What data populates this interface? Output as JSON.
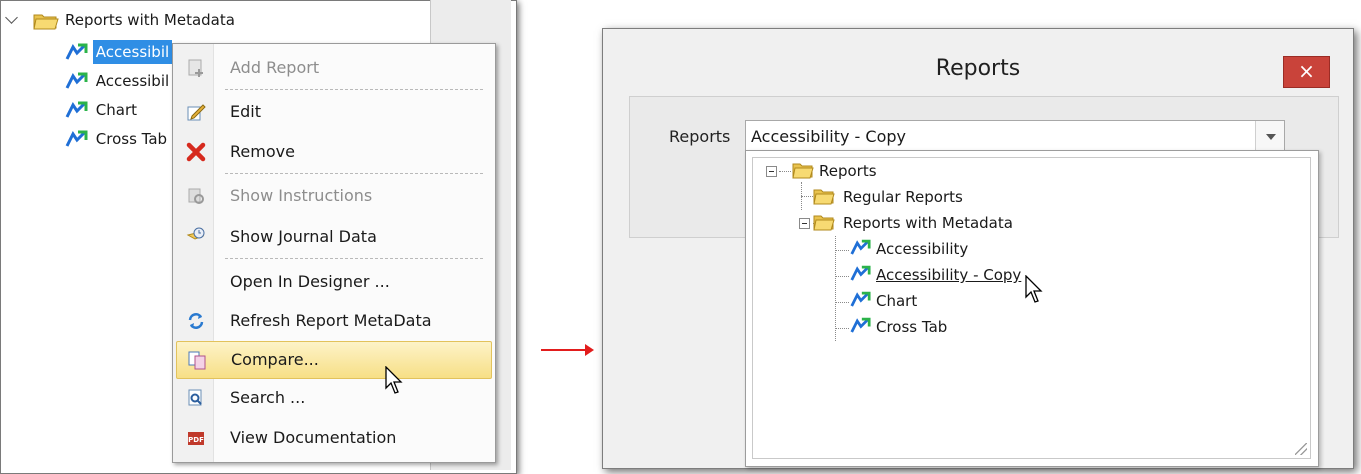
{
  "left_tree": {
    "root_label": "Reports with Metadata",
    "children": [
      {
        "label": "Accessibil"
      },
      {
        "label": "Accessibil"
      },
      {
        "label": "Chart"
      },
      {
        "label": "Cross Tab"
      }
    ]
  },
  "context_menu": {
    "items": [
      {
        "label": "Add Report",
        "icon": "add-report-icon",
        "enabled": false
      },
      {
        "label": "Edit",
        "icon": "edit-icon",
        "enabled": true
      },
      {
        "label": "Remove",
        "icon": "remove-icon",
        "enabled": true
      },
      {
        "label": "Show Instructions",
        "icon": "instructions-icon",
        "enabled": false
      },
      {
        "label": "Show Journal Data",
        "icon": "journal-icon",
        "enabled": true
      },
      {
        "label": "Open In Designer ...",
        "icon": "",
        "enabled": true
      },
      {
        "label": "Refresh Report MetaData",
        "icon": "refresh-icon",
        "enabled": true
      },
      {
        "label": "Compare...",
        "icon": "compare-icon",
        "enabled": true,
        "highlighted": true
      },
      {
        "label": "Search ...",
        "icon": "search-icon",
        "enabled": true
      },
      {
        "label": "View Documentation",
        "icon": "pdf-icon",
        "enabled": true
      }
    ]
  },
  "dialog": {
    "title": "Reports",
    "close_label": "×",
    "field_label": "Reports",
    "combo_value": "Accessibility  - Copy",
    "dropdown_tree": {
      "root": "Reports",
      "regular": "Regular Reports",
      "metadata": "Reports with Metadata",
      "items": [
        "Accessibility",
        "Accessibility  - Copy",
        "Chart",
        "Cross Tab"
      ]
    }
  },
  "colors": {
    "selection": "#2f8ee5",
    "menu_highlight": "#f7df86",
    "close_button": "#c9433a",
    "arrow": "#e21d1d"
  }
}
